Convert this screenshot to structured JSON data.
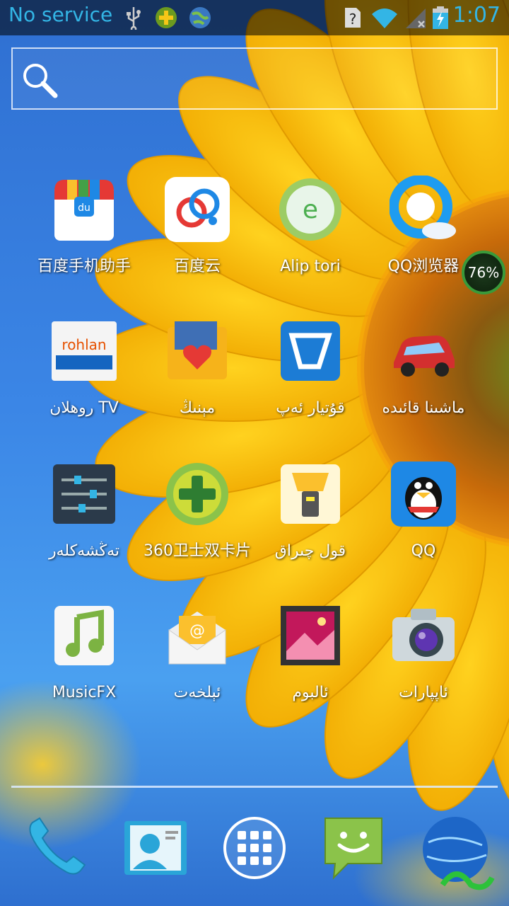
{
  "status_bar": {
    "carrier": "No service",
    "time": "1:07",
    "icons": [
      "usb-icon",
      "game-plus-icon",
      "globe-sync-icon",
      "unknown-sim-icon",
      "wifi-icon",
      "signal-off-icon",
      "battery-charging-icon"
    ]
  },
  "search": {
    "icon": "search-icon"
  },
  "apps": [
    {
      "label": "百度手机助手",
      "icon": "baidu-assistant-icon"
    },
    {
      "label": "百度云",
      "icon": "baidu-cloud-icon"
    },
    {
      "label": "Alip tori",
      "icon": "alip-tori-icon"
    },
    {
      "label": "QQ浏览器",
      "icon": "qq-browser-icon"
    },
    {
      "label": "روهلان TV",
      "icon": "rohlan-tv-icon"
    },
    {
      "label": "مېنىڭ",
      "icon": "my-folder-icon"
    },
    {
      "label": "قۇتيار ئەپ",
      "icon": "qutyar-app-icon"
    },
    {
      "label": "ماشىنا قائىدە",
      "icon": "car-rules-icon"
    },
    {
      "label": "تەڭشەكلەر",
      "icon": "settings-icon"
    },
    {
      "label": "360卫士双卡片",
      "icon": "360-security-icon"
    },
    {
      "label": "قول چىراق",
      "icon": "flashlight-icon"
    },
    {
      "label": "QQ",
      "icon": "qq-penguin-icon"
    },
    {
      "label": "MusicFX",
      "icon": "musicfx-icon"
    },
    {
      "label": "ئېلخەت",
      "icon": "email-icon"
    },
    {
      "label": "ئالبوم",
      "icon": "album-icon"
    },
    {
      "label": "ئاپپارات",
      "icon": "camera-icon"
    }
  ],
  "battery_widget": {
    "value": "76%"
  },
  "dock": [
    "phone-icon",
    "contacts-icon",
    "app-drawer-icon",
    "messaging-icon",
    "alip-globe-icon"
  ]
}
